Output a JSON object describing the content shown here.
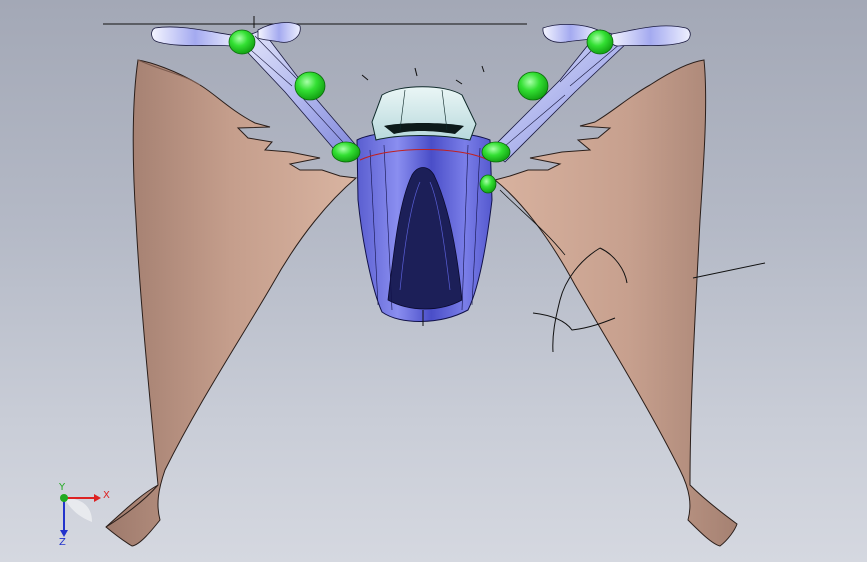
{
  "viewport": {
    "background_top": "#a3a8b6",
    "background_bottom": "#d5d8e0"
  },
  "model": {
    "wing_color": "#c8a08e",
    "wing_edge": "#2a1e1a",
    "body_color": "#6b6fe0",
    "canopy_color": "#d4ecec",
    "arm_color": "#bcc2f0",
    "joint_color": "#22dd22"
  },
  "triad": {
    "x_label": "X",
    "y_label": "Y",
    "z_label": "Z",
    "x_color": "#dd2222",
    "y_color": "#22aa22",
    "z_color": "#2233cc"
  }
}
